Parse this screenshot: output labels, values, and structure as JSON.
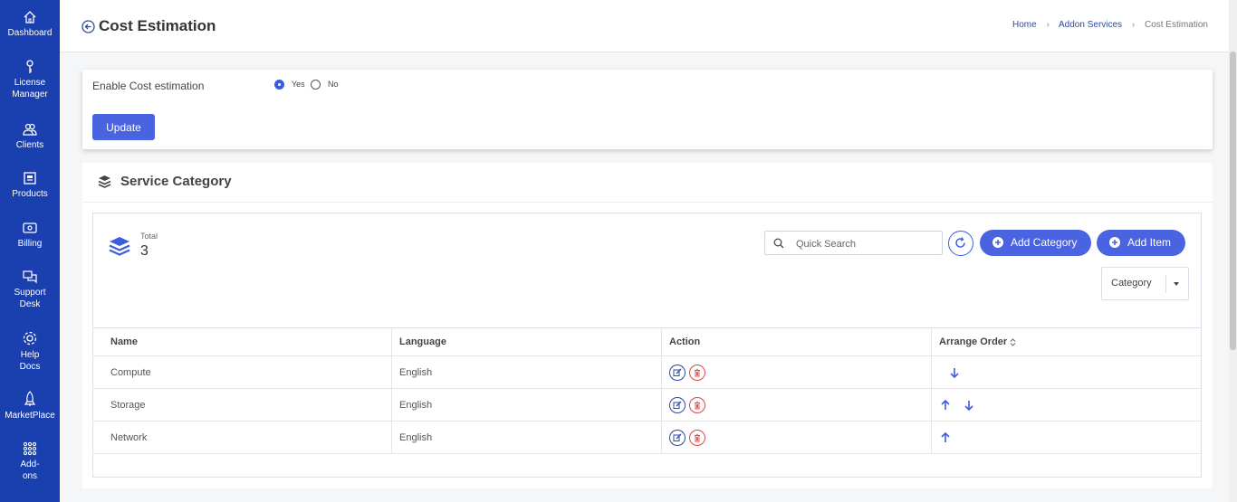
{
  "sidebar": {
    "items": [
      {
        "label": "Dashboard",
        "icon": "home-icon"
      },
      {
        "label": "License Manager",
        "icon": "key-icon"
      },
      {
        "label": "Clients",
        "icon": "users-icon"
      },
      {
        "label": "Products",
        "icon": "products-icon"
      },
      {
        "label": "Billing",
        "icon": "billing-icon"
      },
      {
        "label": "Support Desk",
        "icon": "chat-icon"
      },
      {
        "label": "Help Docs",
        "icon": "gear-icon"
      },
      {
        "label": "MarketPlace",
        "icon": "rocket-icon"
      },
      {
        "label": "Add-ons",
        "icon": "grid-icon"
      }
    ]
  },
  "header": {
    "title": "Cost Estimation",
    "breadcrumb": [
      "Home",
      "Addon Services",
      "Cost Estimation"
    ]
  },
  "enable_card": {
    "label": "Enable Cost estimation",
    "options": [
      "Yes",
      "No"
    ],
    "selected": "Yes",
    "update_label": "Update"
  },
  "service_category": {
    "title": "Service Category",
    "total_label": "Total",
    "total_value": "3",
    "search_placeholder": "Quick Search",
    "add_category_label": "Add Category",
    "add_item_label": "Add Item",
    "filter_value": "Category",
    "columns": [
      "Name",
      "Language",
      "Action",
      "Arrange Order"
    ],
    "rows": [
      {
        "name": "Compute",
        "language": "English",
        "up": false,
        "down": true
      },
      {
        "name": "Storage",
        "language": "English",
        "up": true,
        "down": true
      },
      {
        "name": "Network",
        "language": "English",
        "up": true,
        "down": false
      }
    ]
  },
  "colors": {
    "sidebar": "#1a3fae",
    "primary": "#4a63e0",
    "delete": "#d94848"
  }
}
